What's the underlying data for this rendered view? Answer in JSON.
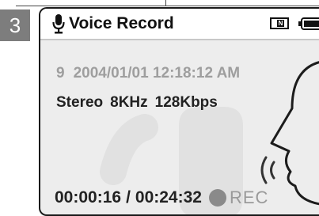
{
  "step_number": "3",
  "titlebar": {
    "title": "Voice Record",
    "mic_icon": "microphone-icon",
    "mode_icon": "internal-memory-icon",
    "mode_icon_letter": "N",
    "battery_icon": "battery-icon"
  },
  "recording": {
    "track_number": "9",
    "date": "2004/01/01",
    "time": "12:18:12 AM",
    "channel": "Stereo",
    "sample_rate": "8KHz",
    "bitrate": "128Kbps",
    "elapsed": "00:00:16",
    "separator": "/",
    "total": "00:24:32",
    "status_label": "REC"
  },
  "colors": {
    "screen_bg": "#ededed",
    "step_badge": "#7d7d7d",
    "rec_dot": "#8a8a8a"
  }
}
